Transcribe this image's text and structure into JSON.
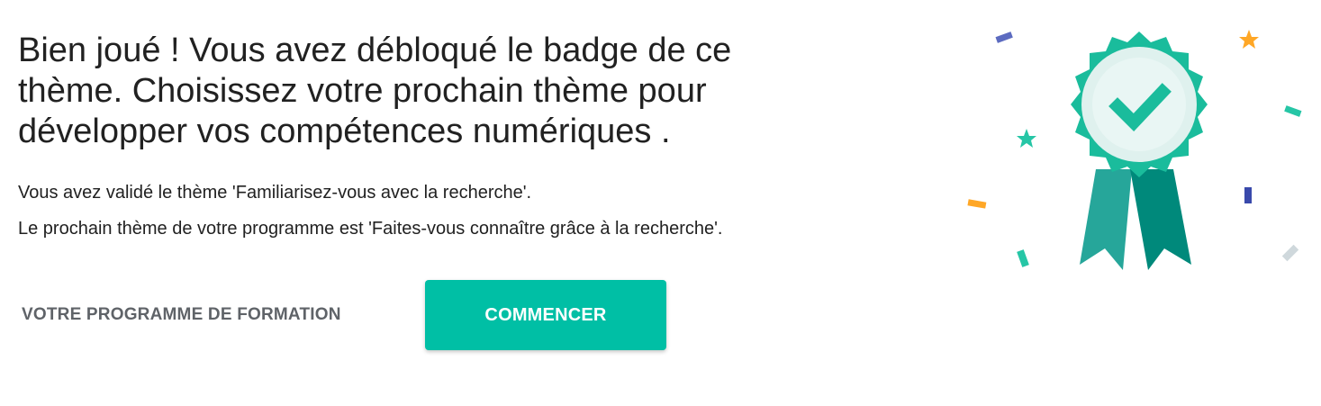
{
  "headline": "Bien joué ! Vous avez débloqué le badge de ce thème. Choisissez votre prochain thème pour développer vos compétences numériques .",
  "body": {
    "line1": "Vous avez validé le thème 'Familiarisez-vous avec la recherche'.",
    "line2": "Le prochain thème de votre programme est 'Faites-vous connaître grâce à la recherche'."
  },
  "actions": {
    "program_label": "VOTRE PROGRAMME DE FORMATION",
    "start_label": "COMMENCER"
  },
  "colors": {
    "accent": "#00bfa5",
    "badge_dark": "#00897b",
    "text_secondary": "#5f6368"
  },
  "icons": {
    "badge": "award-ribbon-check-icon",
    "confetti": "confetti-icon"
  }
}
